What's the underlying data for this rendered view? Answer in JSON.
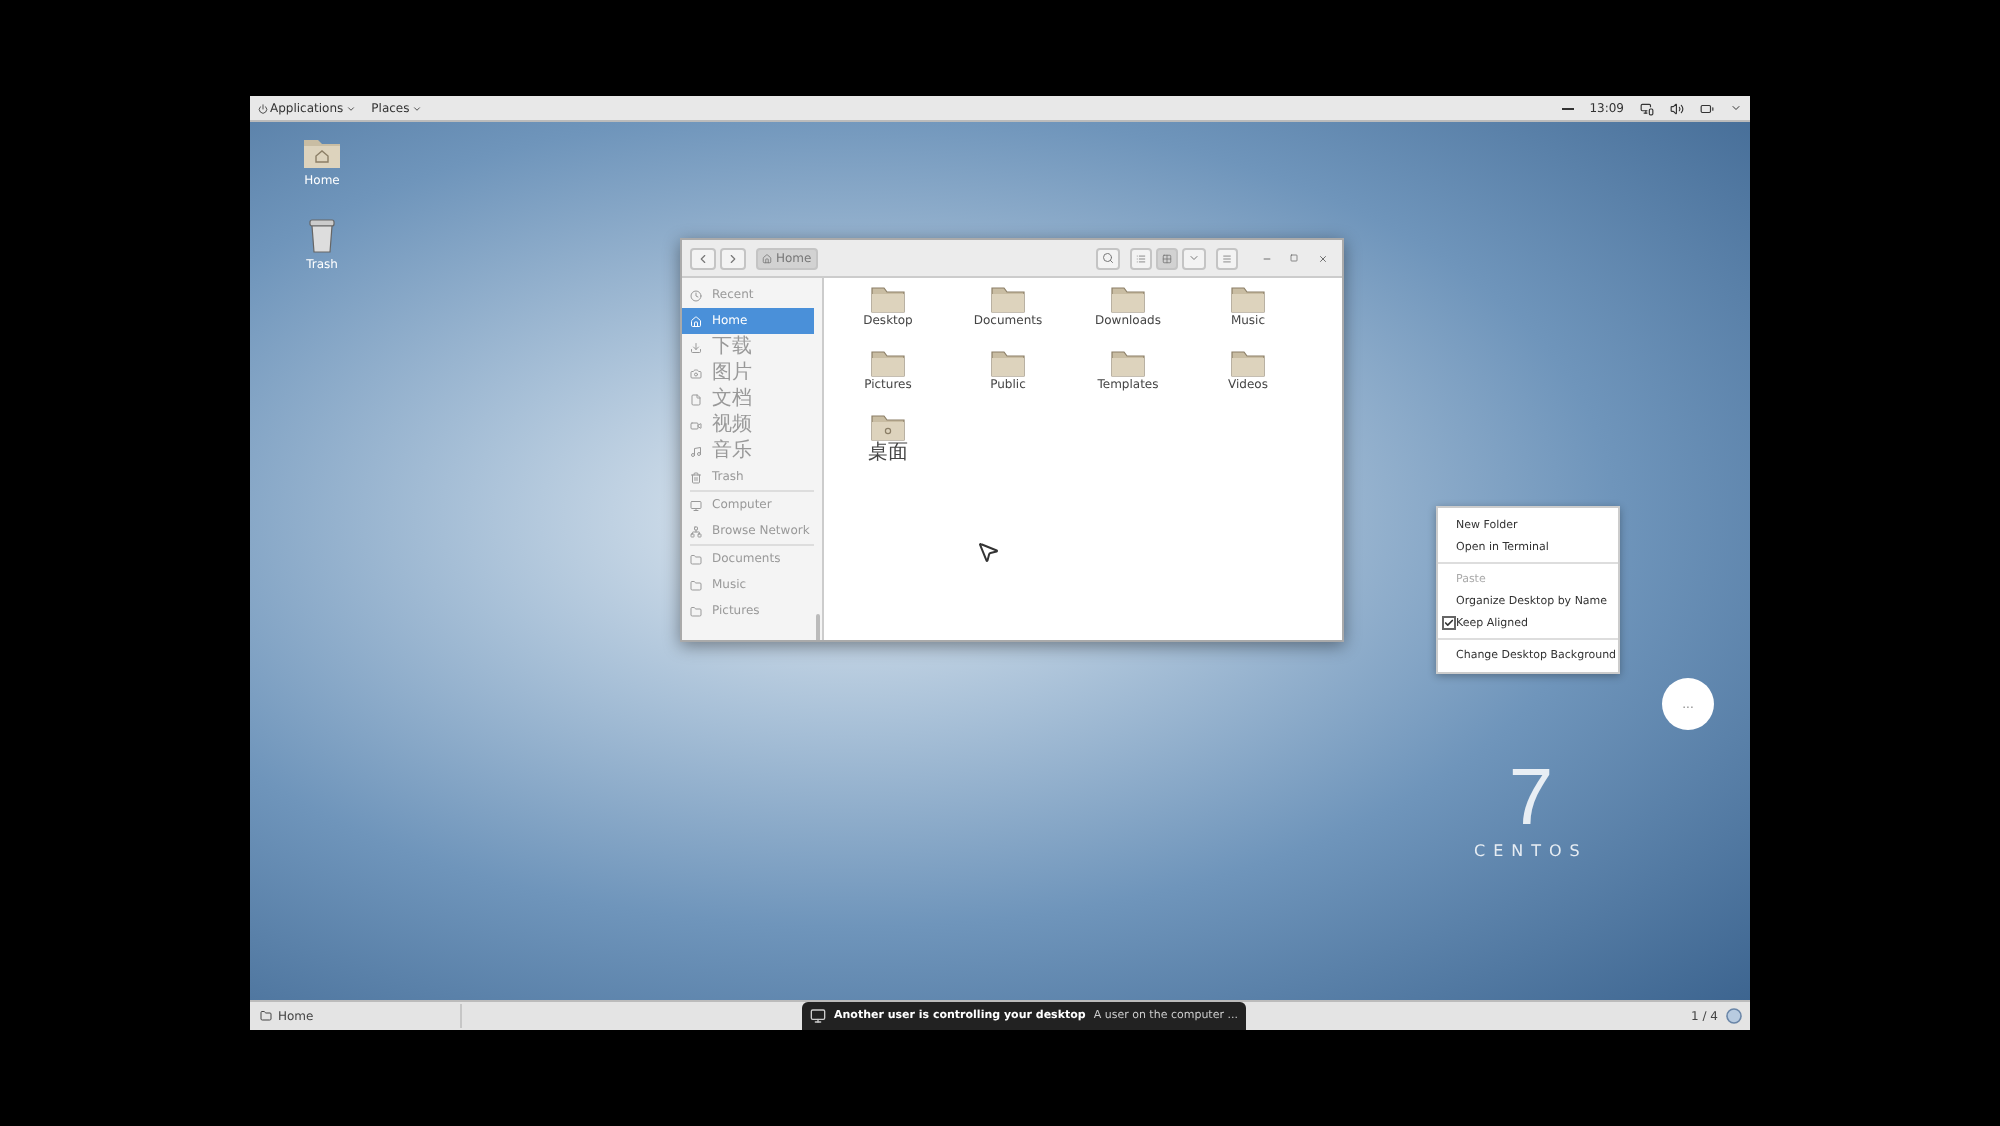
{
  "top_bar": {
    "menus": [
      {
        "label": "Applications"
      },
      {
        "label": "Places"
      }
    ],
    "clock": "13:09"
  },
  "desktop_icons": [
    {
      "kind": "home",
      "label": "Home"
    },
    {
      "kind": "trash",
      "label": "Trash"
    }
  ],
  "file_window": {
    "path": "Home",
    "view_buttons": [
      {
        "kind": "list",
        "selected": false
      },
      {
        "kind": "grid",
        "selected": true
      }
    ],
    "sidebar": [
      {
        "kind": "item",
        "label": "Recent",
        "selected": false
      },
      {
        "kind": "item",
        "label": "Home",
        "selected": true
      },
      {
        "kind": "item",
        "label": "下载",
        "selected": false
      },
      {
        "kind": "item",
        "label": "图片",
        "selected": false
      },
      {
        "kind": "item",
        "label": "文档",
        "selected": false
      },
      {
        "kind": "item",
        "label": "视频",
        "selected": false
      },
      {
        "kind": "item",
        "label": "音乐",
        "selected": false
      },
      {
        "kind": "item",
        "label": "Trash",
        "selected": false
      },
      {
        "kind": "separator"
      },
      {
        "kind": "item",
        "label": "Computer",
        "selected": false
      },
      {
        "kind": "item",
        "label": "Browse Network",
        "selected": false
      },
      {
        "kind": "separator"
      },
      {
        "kind": "item",
        "label": "Documents",
        "selected": false
      },
      {
        "kind": "item",
        "label": "Music",
        "selected": false
      },
      {
        "kind": "item",
        "label": "Pictures",
        "selected": false
      }
    ],
    "files": [
      {
        "name": "Desktop"
      },
      {
        "name": "Documents"
      },
      {
        "name": "Downloads"
      },
      {
        "name": "Music"
      },
      {
        "name": "Pictures"
      },
      {
        "name": "Public"
      },
      {
        "name": "Templates"
      },
      {
        "name": "Videos"
      },
      {
        "name": "桌面"
      }
    ]
  },
  "context_menu": [
    {
      "kind": "item",
      "label": "New Folder",
      "disabled": false
    },
    {
      "kind": "item",
      "label": "Open in Terminal",
      "disabled": false
    },
    {
      "kind": "separator"
    },
    {
      "kind": "item",
      "label": "Paste",
      "disabled": true
    },
    {
      "kind": "item",
      "label": "Organize Desktop by Name",
      "disabled": false
    },
    {
      "kind": "check",
      "label": "Keep Aligned",
      "checked": true
    },
    {
      "kind": "separator"
    },
    {
      "kind": "item",
      "label": "Change Desktop Background",
      "disabled": false
    }
  ],
  "overflow_button": {
    "label": "..."
  },
  "logo": {
    "number": "7",
    "name": "CENTOS"
  },
  "bottom_bar": {
    "window_button": "Home",
    "notification": {
      "title": "Another user is controlling your desktop",
      "body": "A user on the computer ..."
    },
    "workspace": "1 / 4"
  }
}
